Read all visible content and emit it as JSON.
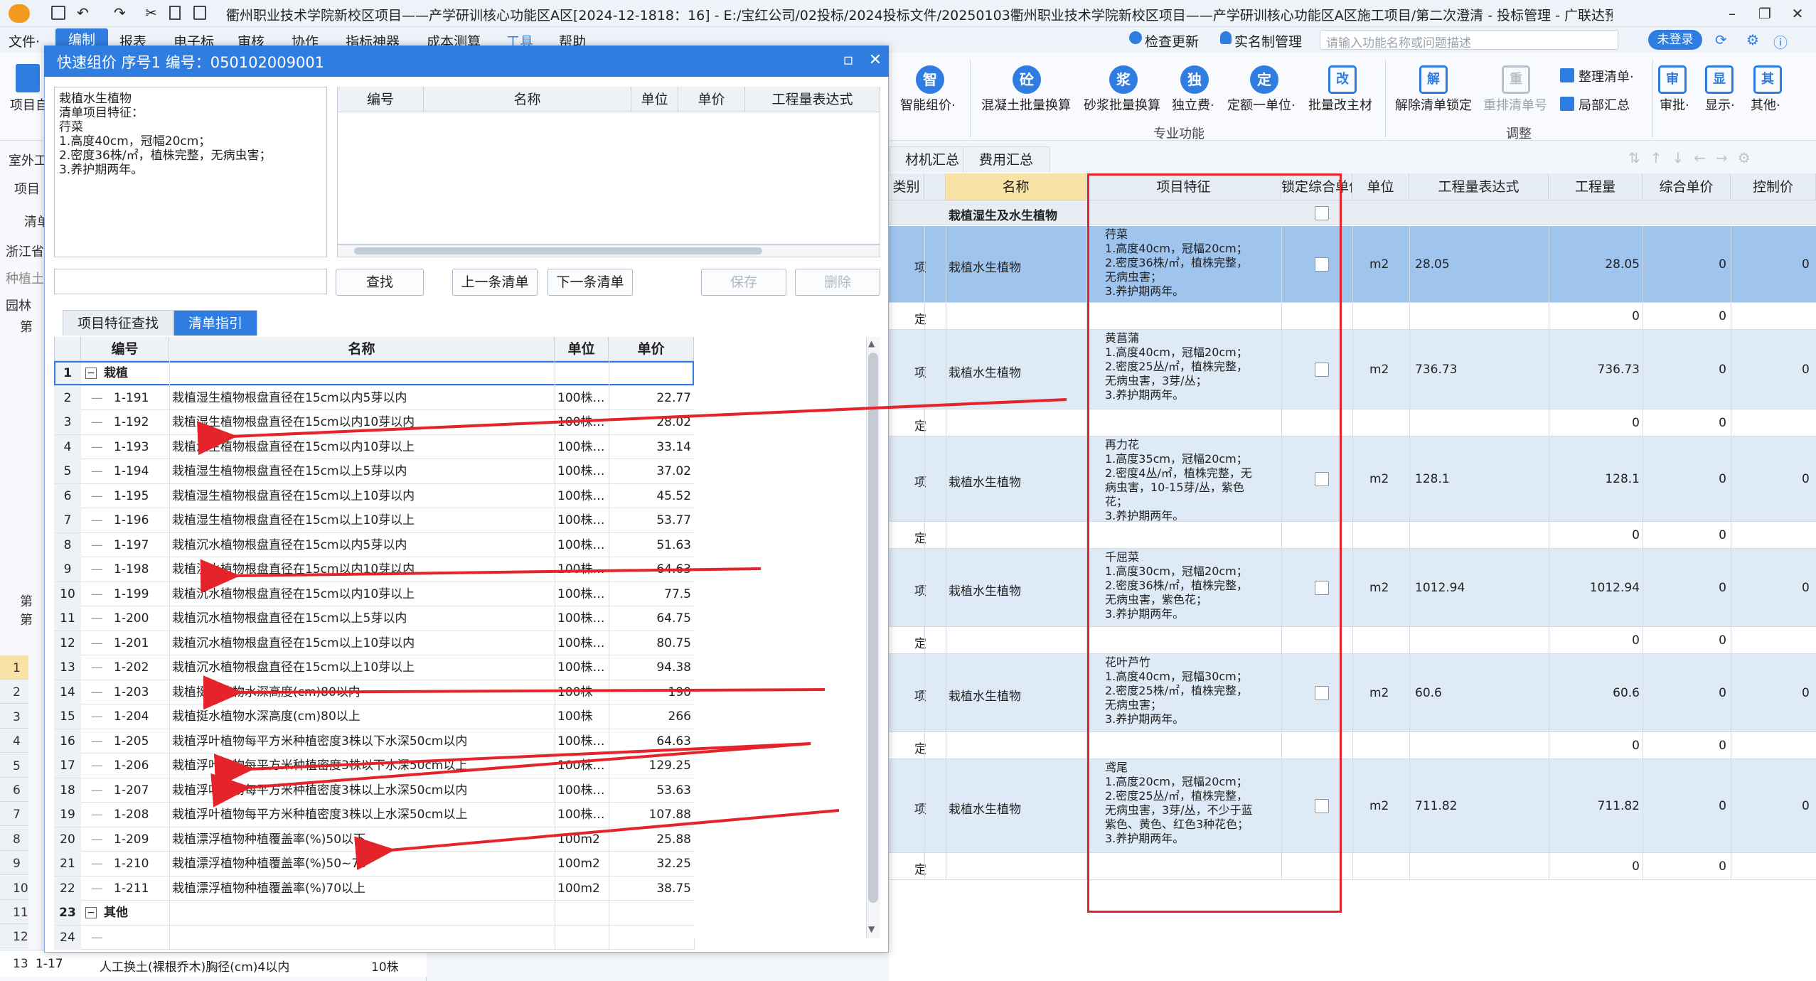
{
  "app": {
    "title": "衢州职业技术学院新校区项目——产学研训核心功能区A区[2024-12-1818：16] - E:/宝红公司/02投标/2024投标文件/20250103衢州职业技术学院新校区项目——产学研训核心功能区A区施工项目/第二次澄清 - 投标管理 - 广联达预算计价",
    "menus": [
      "文件·",
      "编制",
      "报表",
      "电子标",
      "审核",
      "协作",
      "指标神器",
      "成本测算",
      "工具",
      "帮助"
    ],
    "right_tools": [
      "检查更新",
      "实名制管理"
    ],
    "search_placeholder": "请输入功能名称或问题描述",
    "login": "未登录"
  },
  "ribbon": {
    "left_label": "项目自",
    "buttons": [
      {
        "label": "智能组价·",
        "glyph": "智"
      },
      {
        "label": "混凝土批量换算",
        "glyph": "砼"
      },
      {
        "label": "砂浆批量换算",
        "glyph": "浆"
      },
      {
        "label": "独立费·",
        "glyph": "独"
      },
      {
        "label": "定额一单位·",
        "glyph": "定"
      },
      {
        "label": "批量改主材",
        "glyph": "改"
      },
      {
        "label": "解除清单锁定",
        "glyph": "解"
      },
      {
        "label": "重排清单号",
        "glyph": "重"
      },
      {
        "label": "审批·",
        "glyph": "审"
      },
      {
        "label": "显示·",
        "glyph": "显"
      },
      {
        "label": "其他·",
        "glyph": "其"
      }
    ],
    "small_buttons": [
      "整理清单·",
      "局部汇总"
    ],
    "groups": [
      "专业功能",
      "调整"
    ]
  },
  "main": {
    "tabs": [
      "材机汇总",
      "费用汇总"
    ],
    "columns": [
      "类别",
      "名称",
      "项目特征",
      "锁定综合单价",
      "单位",
      "工程量表达式",
      "工程量",
      "综合单价",
      "控制价"
    ],
    "category_row": "栽植湿生及水生植物",
    "rows": [
      {
        "type": "项",
        "name": "栽植水生植物",
        "feature": "荇菜\n1.高度40cm，冠幅20cm；\n2.密度36株/㎡，植株完整，\n无病虫害；\n3.养护期两年。",
        "unit": "m2",
        "expr": "28.05",
        "qty": "28.05",
        "price": "0",
        "ctrl": "0"
      },
      {
        "type": "定",
        "qty": "0",
        "price": "0"
      },
      {
        "type": "项",
        "name": "栽植水生植物",
        "feature": "黄菖蒲\n1.高度40cm，冠幅20cm；\n2.密度25丛/㎡，植株完整，\n无病虫害，3芽/丛；\n3.养护期两年。",
        "unit": "m2",
        "expr": "736.73",
        "qty": "736.73",
        "price": "0",
        "ctrl": "0"
      },
      {
        "type": "定",
        "qty": "0",
        "price": "0"
      },
      {
        "type": "项",
        "name": "栽植水生植物",
        "feature": "再力花\n1.高度35cm，冠幅20cm；\n2.密度4丛/㎡，植株完整，无\n病虫害，10-15芽/丛，紫色\n花；\n3.养护期两年。",
        "unit": "m2",
        "expr": "128.1",
        "qty": "128.1",
        "price": "0",
        "ctrl": "0"
      },
      {
        "type": "定",
        "qty": "0",
        "price": "0"
      },
      {
        "type": "项",
        "name": "栽植水生植物",
        "feature": "千屈菜\n1.高度30cm，冠幅20cm；\n2.密度36株/㎡，植株完整，\n无病虫害，紫色花；\n3.养护期两年。",
        "unit": "m2",
        "expr": "1012.94",
        "qty": "1012.94",
        "price": "0",
        "ctrl": "0"
      },
      {
        "type": "定",
        "qty": "0",
        "price": "0"
      },
      {
        "type": "项",
        "name": "栽植水生植物",
        "feature": "花叶芦竹\n1.高度40cm，冠幅30cm；\n2.密度25株/㎡，植株完整，\n无病虫害；\n3.养护期两年。",
        "unit": "m2",
        "expr": "60.6",
        "qty": "60.6",
        "price": "0",
        "ctrl": "0"
      },
      {
        "type": "定",
        "qty": "0",
        "price": "0"
      },
      {
        "type": "项",
        "name": "栽植水生植物",
        "feature": "鸢尾\n1.高度20cm，冠幅20cm；\n2.密度25丛/㎡，植株完整，\n无病虫害，3芽/丛，不少于蓝\n紫色、黄色、红色3种花色；\n3.养护期两年。",
        "unit": "m2",
        "expr": "711.82",
        "qty": "711.82",
        "price": "0",
        "ctrl": "0"
      },
      {
        "type": "定",
        "qty": "0",
        "price": "0"
      }
    ]
  },
  "background_left": {
    "labels": [
      "室外工",
      "项目",
      "清单",
      "浙江省",
      "种植土",
      "园林",
      "第",
      "第",
      "第"
    ],
    "row_numbers": [
      "1",
      "2",
      "3",
      "4",
      "5",
      "6",
      "7",
      "8",
      "9",
      "10",
      "11",
      "12",
      "13"
    ],
    "bottom_row": {
      "code": "1-17",
      "name": "人工换土(裸根乔木)胸径(cm)4以内",
      "unit": "10株"
    }
  },
  "dialog": {
    "title": "快速组价 序号1 编号：050102009001",
    "feature_text": "栽植水生植物\n清单项目特征：\n荇菜\n1.高度40cm，冠幅20cm；\n2.密度36株/㎡，植株完整，无病虫害；\n3.养护期两年。",
    "top_table_headers": [
      "编号",
      "名称",
      "单位",
      "单价",
      "工程量表达式"
    ],
    "buttons": {
      "find": "查找",
      "prev": "上一条清单",
      "next": "下一条清单",
      "save": "保存",
      "delete": "删除"
    },
    "subtabs": [
      "项目特征查找",
      "清单指引"
    ],
    "list_headers": [
      "编号",
      "名称",
      "单位",
      "单价"
    ],
    "list": [
      {
        "n": "1",
        "group": "栽植"
      },
      {
        "n": "2",
        "code": "1-191",
        "name": "栽植湿生植物根盘直径在15cm以内5芽以内",
        "unit": "100株…",
        "price": "22.77"
      },
      {
        "n": "3",
        "code": "1-192",
        "name": "栽植湿生植物根盘直径在15cm以内10芽以内",
        "unit": "100株…",
        "price": "28.02"
      },
      {
        "n": "4",
        "code": "1-193",
        "name": "栽植湿生植物根盘直径在15cm以内10芽以上",
        "unit": "100株…",
        "price": "33.14"
      },
      {
        "n": "5",
        "code": "1-194",
        "name": "栽植湿生植物根盘直径在15cm以上5芽以内",
        "unit": "100株…",
        "price": "37.02"
      },
      {
        "n": "6",
        "code": "1-195",
        "name": "栽植湿生植物根盘直径在15cm以上10芽以内",
        "unit": "100株…",
        "price": "45.52"
      },
      {
        "n": "7",
        "code": "1-196",
        "name": "栽植湿生植物根盘直径在15cm以上10芽以上",
        "unit": "100株…",
        "price": "53.77"
      },
      {
        "n": "8",
        "code": "1-197",
        "name": "栽植沉水植物根盘直径在15cm以内5芽以内",
        "unit": "100株…",
        "price": "51.63"
      },
      {
        "n": "9",
        "code": "1-198",
        "name": "栽植沉水植物根盘直径在15cm以内10芽以内",
        "unit": "100株…",
        "price": "64.63"
      },
      {
        "n": "10",
        "code": "1-199",
        "name": "栽植沉水植物根盘直径在15cm以内10芽以上",
        "unit": "100株…",
        "price": "77.5"
      },
      {
        "n": "11",
        "code": "1-200",
        "name": "栽植沉水植物根盘直径在15cm以上5芽以内",
        "unit": "100株…",
        "price": "64.75"
      },
      {
        "n": "12",
        "code": "1-201",
        "name": "栽植沉水植物根盘直径在15cm以上10芽以内",
        "unit": "100株…",
        "price": "80.75"
      },
      {
        "n": "13",
        "code": "1-202",
        "name": "栽植沉水植物根盘直径在15cm以上10芽以上",
        "unit": "100株…",
        "price": "94.38"
      },
      {
        "n": "14",
        "code": "1-203",
        "name": "栽植挺水植物水深高度(cm)80以内",
        "unit": "100株",
        "price": "190"
      },
      {
        "n": "15",
        "code": "1-204",
        "name": "栽植挺水植物水深高度(cm)80以上",
        "unit": "100株",
        "price": "266"
      },
      {
        "n": "16",
        "code": "1-205",
        "name": "栽植浮叶植物每平方米种植密度3株以下水深50cm以内",
        "unit": "100株…",
        "price": "64.63"
      },
      {
        "n": "17",
        "code": "1-206",
        "name": "栽植浮叶植物每平方米种植密度3株以下水深50cm以上",
        "unit": "100株…",
        "price": "129.25"
      },
      {
        "n": "18",
        "code": "1-207",
        "name": "栽植浮叶植物每平方米种植密度3株以上水深50cm以内",
        "unit": "100株…",
        "price": "53.63"
      },
      {
        "n": "19",
        "code": "1-208",
        "name": "栽植浮叶植物每平方米种植密度3株以上水深50cm以上",
        "unit": "100株…",
        "price": "107.88"
      },
      {
        "n": "20",
        "code": "1-209",
        "name": "栽植漂浮植物种植覆盖率(%)50以下",
        "unit": "100m2",
        "price": "25.88"
      },
      {
        "n": "21",
        "code": "1-210",
        "name": "栽植漂浮植物种植覆盖率(%)50~70",
        "unit": "100m2",
        "price": "32.25"
      },
      {
        "n": "22",
        "code": "1-211",
        "name": "栽植漂浮植物种植覆盖率(%)70以上",
        "unit": "100m2",
        "price": "38.75"
      },
      {
        "n": "23",
        "group": "其他"
      },
      {
        "n": "24",
        "code": "",
        "name": "",
        "unit": "",
        "price": ""
      }
    ]
  },
  "colors": {
    "accent": "#2f7de1",
    "annotation": "#e5232b",
    "selected_row": "#9fc4ee"
  }
}
